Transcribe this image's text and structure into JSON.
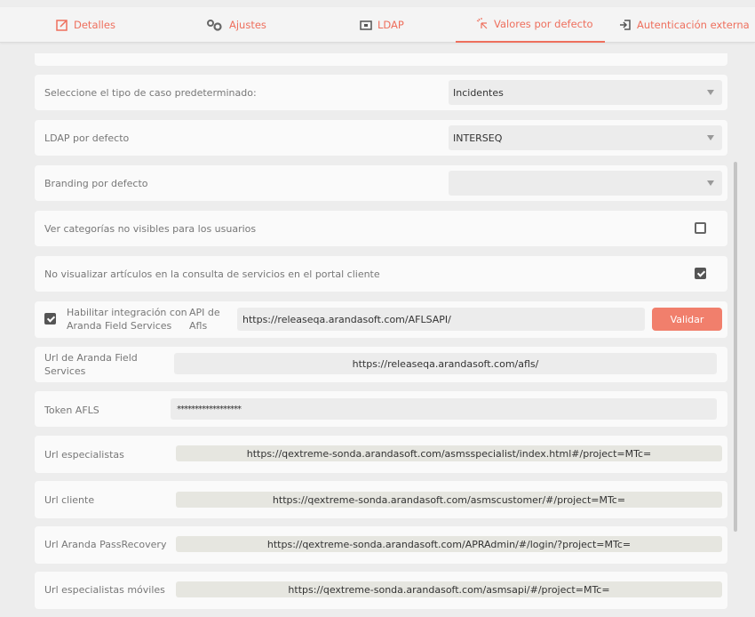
{
  "tabs": [
    {
      "label": "Detalles",
      "icon": "edit-icon"
    },
    {
      "label": "Ajustes",
      "icon": "gears-icon"
    },
    {
      "label": "LDAP",
      "icon": "folder-icon"
    },
    {
      "label": "Valores por defecto",
      "icon": "pointer-click-icon"
    },
    {
      "label": "Autenticación externa",
      "icon": "sign-in-icon"
    }
  ],
  "active_tab": "Valores por defecto",
  "accent_color": "#ee6f5d",
  "settings": {
    "case_type": {
      "label": "Seleccione el tipo de caso predeterminado:",
      "value": "Incidentes"
    },
    "ldap_default": {
      "label": "LDAP por defecto",
      "value": "INTERSEQ"
    },
    "branding_default": {
      "label": "Branding por defecto",
      "value": ""
    },
    "show_hidden_categories": {
      "label": "Ver categorías no visibles para los usuarios",
      "checked": false
    },
    "hide_articles": {
      "label": "No visualizar artículos en la consulta de servicios en el portal cliente",
      "checked": true
    },
    "afls": {
      "label_line1": "Habilitar integración con",
      "label_line2": "Aranda Field Services",
      "checked": true,
      "api_label_line1": "API de",
      "api_label_line2": "Afls",
      "api_value": "https://releaseqa.arandasoft.com/AFLSAPI/",
      "validate_label": "Validar"
    },
    "afls_url": {
      "label_line1": "Url de Aranda Field",
      "label_line2": "Services",
      "value": "https://releaseqa.arandasoft.com/afls/"
    },
    "token_afls": {
      "label": "Token AFLS",
      "value": "******************"
    },
    "url_specialists": {
      "label": "Url especialistas",
      "value": "https://qextreme-sonda.arandasoft.com/asmsspecialist/index.html#/project=MTc="
    },
    "url_client": {
      "label": "Url cliente",
      "value": "https://qextreme-sonda.arandasoft.com/asmscustomer/#/project=MTc="
    },
    "url_passrecovery": {
      "label": "Url Aranda PassRecovery",
      "value": "https://qextreme-sonda.arandasoft.com/APRAdmin/#/login/?project=MTc="
    },
    "url_mobile_specialists": {
      "label": "Url especialistas móviles",
      "value": "https://qextreme-sonda.arandasoft.com/asmsapi/#/project=MTc="
    }
  }
}
